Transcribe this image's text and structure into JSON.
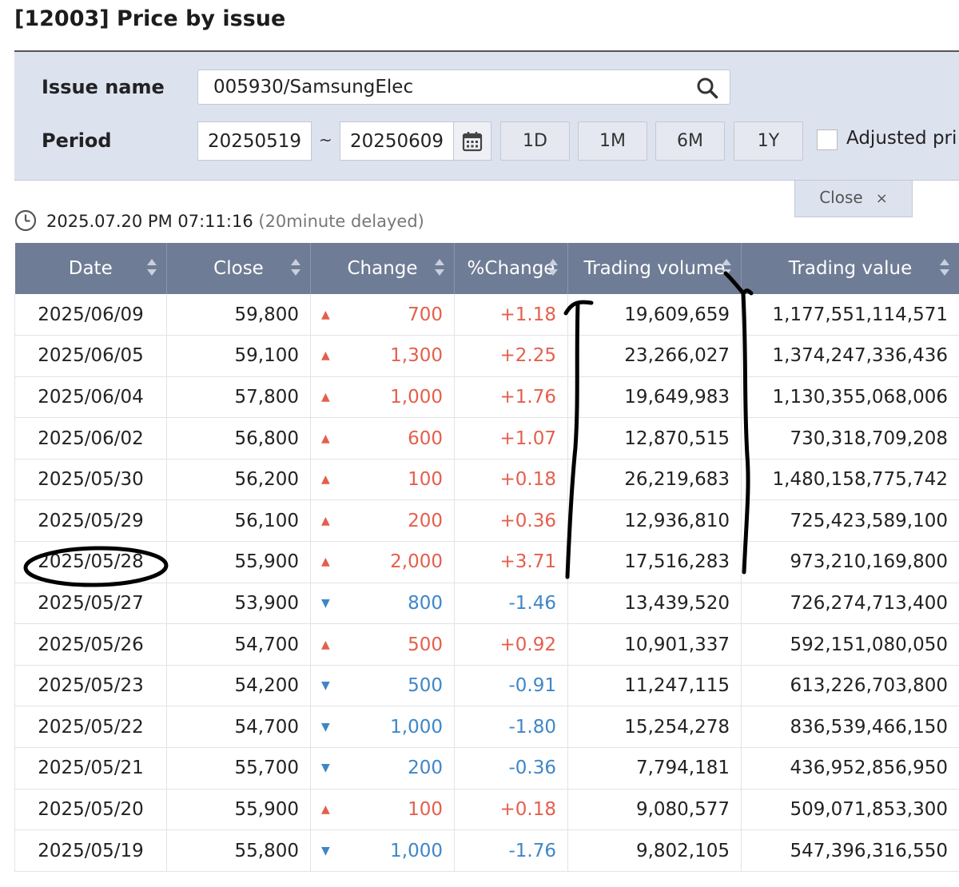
{
  "page": {
    "title": "[12003] Price by issue"
  },
  "search": {
    "issue_label": "Issue name",
    "issue_value": "005930/SamsungElec",
    "period_label": "Period",
    "date_from": "20250519",
    "date_separator": "~",
    "date_to": "20250609",
    "range_buttons": [
      "1D",
      "1M",
      "6M",
      "1Y"
    ],
    "adjusted_label": "Adjusted pri",
    "close_label": "Close",
    "close_glyph": "×"
  },
  "status": {
    "timestamp": "2025.07.20 PM 07:11:16",
    "delay_note": "(20minute delayed)"
  },
  "table": {
    "headers": [
      "Date",
      "Close",
      "Change",
      "%Change",
      "Trading volume",
      "Trading value"
    ],
    "rows": [
      {
        "date": "2025/06/09",
        "close": "59,800",
        "dir": "up",
        "change": "700",
        "pct": "+1.18",
        "volume": "19,609,659",
        "value": "1,177,551,114,571"
      },
      {
        "date": "2025/06/05",
        "close": "59,100",
        "dir": "up",
        "change": "1,300",
        "pct": "+2.25",
        "volume": "23,266,027",
        "value": "1,374,247,336,436"
      },
      {
        "date": "2025/06/04",
        "close": "57,800",
        "dir": "up",
        "change": "1,000",
        "pct": "+1.76",
        "volume": "19,649,983",
        "value": "1,130,355,068,006"
      },
      {
        "date": "2025/06/02",
        "close": "56,800",
        "dir": "up",
        "change": "600",
        "pct": "+1.07",
        "volume": "12,870,515",
        "value": "730,318,709,208"
      },
      {
        "date": "2025/05/30",
        "close": "56,200",
        "dir": "up",
        "change": "100",
        "pct": "+0.18",
        "volume": "26,219,683",
        "value": "1,480,158,775,742"
      },
      {
        "date": "2025/05/29",
        "close": "56,100",
        "dir": "up",
        "change": "200",
        "pct": "+0.36",
        "volume": "12,936,810",
        "value": "725,423,589,100"
      },
      {
        "date": "2025/05/28",
        "close": "55,900",
        "dir": "up",
        "change": "2,000",
        "pct": "+3.71",
        "volume": "17,516,283",
        "value": "973,210,169,800"
      },
      {
        "date": "2025/05/27",
        "close": "53,900",
        "dir": "down",
        "change": "800",
        "pct": "-1.46",
        "volume": "13,439,520",
        "value": "726,274,713,400"
      },
      {
        "date": "2025/05/26",
        "close": "54,700",
        "dir": "up",
        "change": "500",
        "pct": "+0.92",
        "volume": "10,901,337",
        "value": "592,151,080,050"
      },
      {
        "date": "2025/05/23",
        "close": "54,200",
        "dir": "down",
        "change": "500",
        "pct": "-0.91",
        "volume": "11,247,115",
        "value": "613,226,703,800"
      },
      {
        "date": "2025/05/22",
        "close": "54,700",
        "dir": "down",
        "change": "1,000",
        "pct": "-1.80",
        "volume": "15,254,278",
        "value": "836,539,466,150"
      },
      {
        "date": "2025/05/21",
        "close": "55,700",
        "dir": "down",
        "change": "200",
        "pct": "-0.36",
        "volume": "7,794,181",
        "value": "436,952,856,950"
      },
      {
        "date": "2025/05/20",
        "close": "55,900",
        "dir": "up",
        "change": "100",
        "pct": "+0.18",
        "volume": "9,080,577",
        "value": "509,071,853,300"
      },
      {
        "date": "2025/05/19",
        "close": "55,800",
        "dir": "down",
        "change": "1,000",
        "pct": "-1.76",
        "volume": "9,802,105",
        "value": "547,396,316,550"
      }
    ]
  },
  "glyphs": {
    "up": "▲",
    "down": "▼"
  },
  "colors": {
    "up": "#e45f4c",
    "down": "#3f86c8",
    "header_bg": "#6f7c95",
    "panel_bg": "#dde2ef"
  },
  "icons": {
    "search": "search-icon",
    "calendar": "calendar-icon",
    "clock": "clock-icon",
    "sort": "sort-icon"
  }
}
